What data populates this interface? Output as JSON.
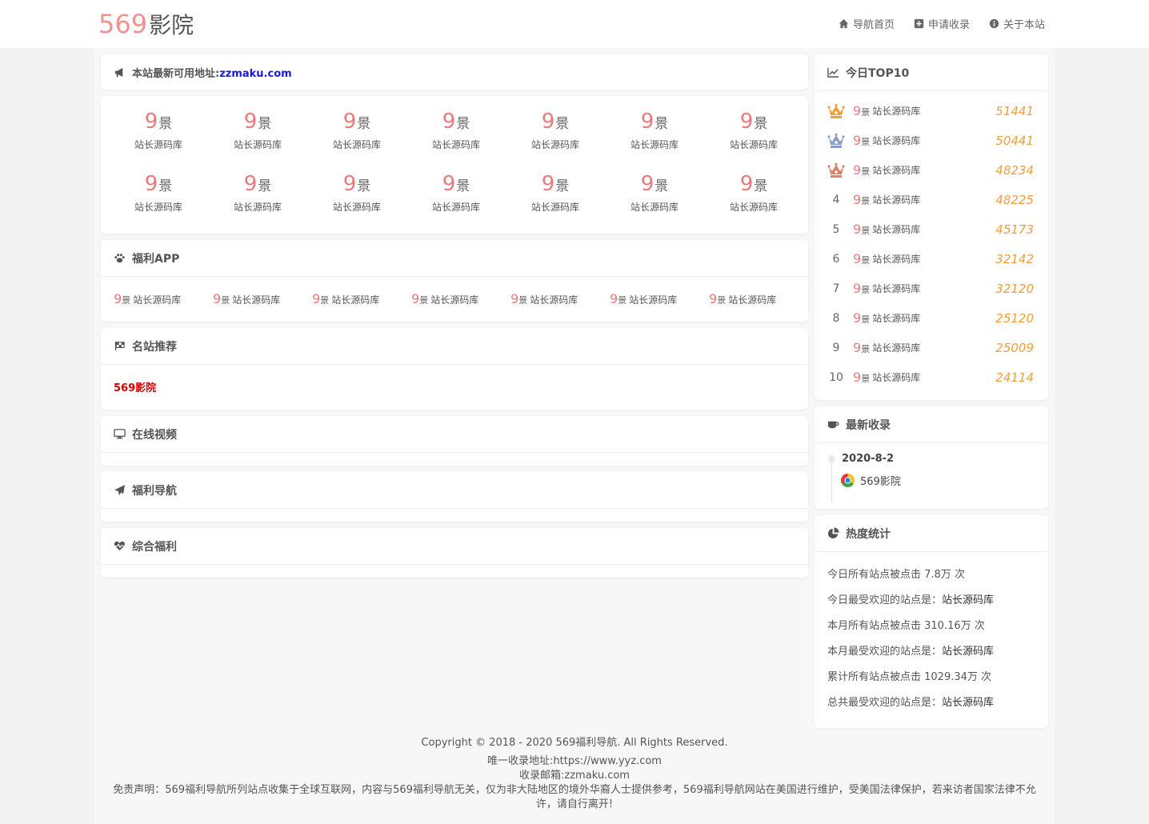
{
  "header": {
    "logo_num": "569",
    "logo_cn": "影院",
    "nav": [
      "导航首页",
      "申请收录",
      "关于本站"
    ]
  },
  "announce": {
    "text": "本站最新可用地址:",
    "link": "zzmaku.com"
  },
  "grid": {
    "logo_num": "9",
    "logo_cn": "景",
    "items": [
      "站长源码库",
      "站长源码库",
      "站长源码库",
      "站长源码库",
      "站长源码库",
      "站长源码库",
      "站长源码库",
      "站长源码库",
      "站长源码库",
      "站长源码库",
      "站长源码库",
      "站长源码库",
      "站长源码库",
      "站长源码库"
    ]
  },
  "app": {
    "title": "福利APP",
    "items": [
      "站长源码库",
      "站长源码库",
      "站长源码库",
      "站长源码库",
      "站长源码库",
      "站长源码库",
      "站长源码库"
    ]
  },
  "recommend": {
    "title": "名站推荐",
    "link": "569影院"
  },
  "video": {
    "title": "在线视频"
  },
  "fnav": {
    "title": "福利导航"
  },
  "misc": {
    "title": "综合福利"
  },
  "top10": {
    "title": "今日TOP10",
    "medal_colors": [
      "#f0a030",
      "#8a9cc8",
      "#e08060"
    ],
    "rows": [
      {
        "rank": "1",
        "name": "站长源码库",
        "value": "51441"
      },
      {
        "rank": "2",
        "name": "站长源码库",
        "value": "50441"
      },
      {
        "rank": "3",
        "name": "站长源码库",
        "value": "48234"
      },
      {
        "rank": "4",
        "name": "站长源码库",
        "value": "48225"
      },
      {
        "rank": "5",
        "name": "站长源码库",
        "value": "45173"
      },
      {
        "rank": "6",
        "name": "站长源码库",
        "value": "32142"
      },
      {
        "rank": "7",
        "name": "站长源码库",
        "value": "32120"
      },
      {
        "rank": "8",
        "name": "站长源码库",
        "value": "25120"
      },
      {
        "rank": "9",
        "name": "站长源码库",
        "value": "25009"
      },
      {
        "rank": "10",
        "name": "站长源码库",
        "value": "24114"
      }
    ]
  },
  "newest": {
    "title": "最新收录",
    "date": "2020-8-2",
    "item": "569影院"
  },
  "heat": {
    "title": "热度统计",
    "rows": [
      {
        "label": "今日所有站点被点击 7.8万 次",
        "value": ""
      },
      {
        "label": "今日最受欢迎的站点是：",
        "value": "站长源码库"
      },
      {
        "label": "本月所有站点被点击 310.16万 次",
        "value": ""
      },
      {
        "label": "本月最受欢迎的站点是：",
        "value": "站长源码库"
      },
      {
        "label": "累计所有站点被点击 1029.34万 次",
        "value": ""
      },
      {
        "label": "总共最受欢迎的站点是：",
        "value": "站长源码库"
      }
    ]
  },
  "footer": {
    "copyright": "Copyright © 2018 - 2020 569福利导航. All Rights Reserved.",
    "address": "唯一收录地址:https://www.yyz.com",
    "email": "收录邮箱:zzmaku.com",
    "disclaimer": "免责声明：569福利导航所列站点收集于全球互联网，内容与569福利导航无关，仅为非大陆地区的境外华裔人士提供参考，569福利导航网站在美国进行维护，受美国法律保护，若来访者国家法律不允许，请自行离开!"
  }
}
